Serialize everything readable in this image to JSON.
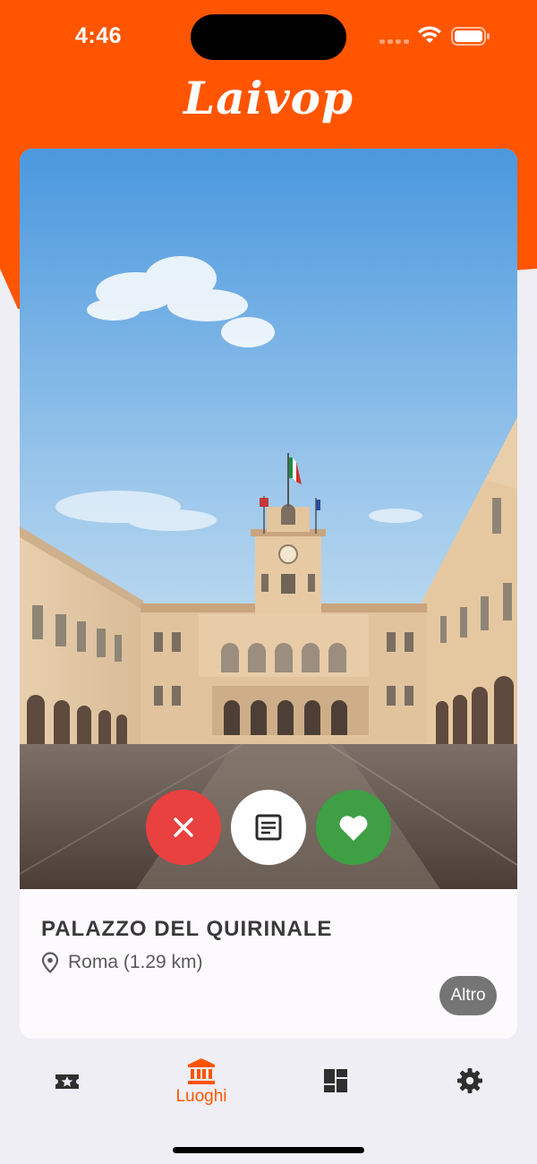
{
  "status_bar": {
    "time": "4:46"
  },
  "app": {
    "logo_text": "Laivop",
    "brand_color": "#FF5500"
  },
  "card": {
    "place_name": "PALAZZO DEL QUIRINALE",
    "location": "Roma (1.29 km)",
    "more_label": "Altro",
    "actions": [
      {
        "name": "reject",
        "icon": "close-icon",
        "color": "#E94040"
      },
      {
        "name": "details",
        "icon": "article-icon",
        "color": "#FFFFFF"
      },
      {
        "name": "like",
        "icon": "heart-icon",
        "color": "#3E9F45"
      }
    ]
  },
  "tabbar": {
    "tabs": [
      {
        "icon": "ticket-star-icon",
        "label": "",
        "active": false
      },
      {
        "icon": "museum-icon",
        "label": "Luoghi",
        "active": true
      },
      {
        "icon": "dashboard-icon",
        "label": "",
        "active": false
      },
      {
        "icon": "gear-icon",
        "label": "",
        "active": false
      }
    ]
  }
}
